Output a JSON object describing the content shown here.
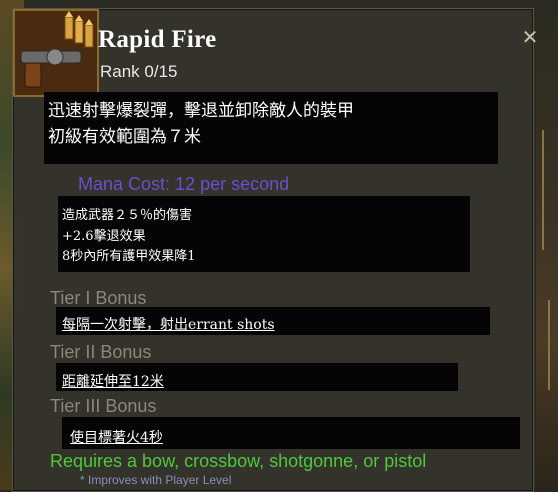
{
  "skill": {
    "name": "Rapid Fire",
    "rank": "Rank 0/15",
    "description_line1": "迅速射擊爆裂彈，擊退並卸除敵人的裝甲",
    "description_line2": "初級有效範圍為７米",
    "mana_cost": "Mana Cost: 12 per second",
    "effects": [
      "造成武器２５％的傷害",
      "+2.6擊退效果",
      "8秒內所有護甲效果降1"
    ]
  },
  "tiers": [
    {
      "label": "Tier I Bonus",
      "value": "每隔一次射擊，射出errant shots"
    },
    {
      "label": "Tier II Bonus",
      "value": "距離延伸至12米"
    },
    {
      "label": "Tier III Bonus",
      "value": "使目標著火4秒"
    }
  ],
  "requirement": "Requires a bow, crossbow, shotgonne, or pistol",
  "improves_note": "* Improves with Player Level",
  "icons": {
    "skill": "gun-bullets-icon",
    "close": "close-icon"
  },
  "colors": {
    "title": "#ffffff",
    "mana": "#6a4fcf",
    "tier_label": "#8a887a",
    "requirement": "#4fc93a",
    "improves": "#8a8fb8"
  }
}
